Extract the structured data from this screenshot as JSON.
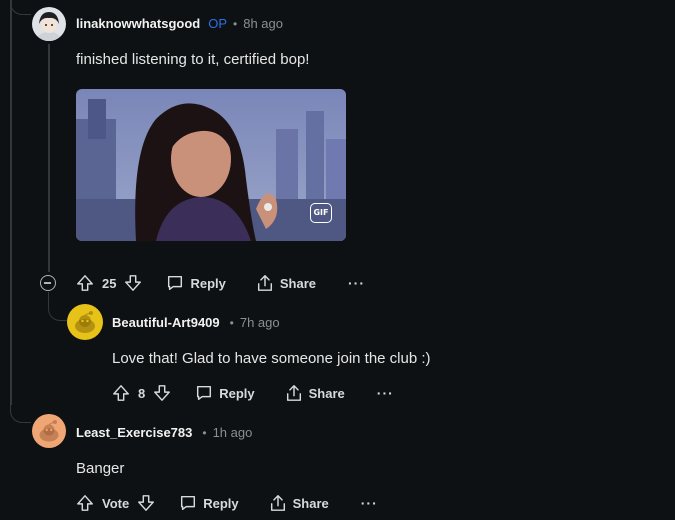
{
  "comments": [
    {
      "username": "linaknowwhatsgood",
      "op_badge": "OP",
      "separator": "•",
      "time": "8h ago",
      "body": "finished listening to it, certified bop!",
      "gif_badge": "GIF",
      "score": "25",
      "reply_label": "Reply",
      "share_label": "Share",
      "more_label": "···"
    },
    {
      "username": "Beautiful-Art9409",
      "separator": "•",
      "time": "7h ago",
      "body": "Love that! Glad to have someone join the club :)",
      "score": "8",
      "reply_label": "Reply",
      "share_label": "Share",
      "more_label": "···",
      "avatar_color": "#e7c31a"
    },
    {
      "username": "Least_Exercise783",
      "separator": "•",
      "time": "1h ago",
      "body": "Banger",
      "score": "Vote",
      "reply_label": "Reply",
      "share_label": "Share",
      "more_label": "···",
      "avatar_color": "#f0a574"
    }
  ]
}
